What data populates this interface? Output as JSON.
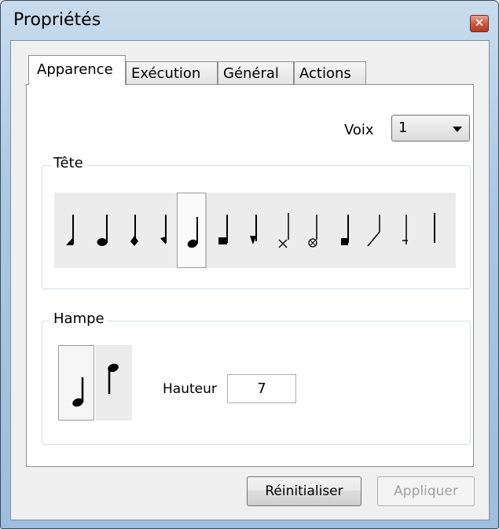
{
  "window": {
    "title": "Propriétés"
  },
  "tabs": [
    {
      "label": "Apparence",
      "active": true
    },
    {
      "label": "Exécution",
      "active": false
    },
    {
      "label": "Général",
      "active": false
    },
    {
      "label": "Actions",
      "active": false
    }
  ],
  "voix": {
    "label": "Voix",
    "value": "1"
  },
  "tete": {
    "title": "Tête",
    "heads": [
      "triangle-head-icon",
      "round-head-icon",
      "diamond-head-icon",
      "half-diamond-head-icon",
      "round-head-selected-icon",
      "square-head-icon",
      "inverted-triangle-head-icon",
      "x-head-icon",
      "circle-x-head-icon",
      "small-square-head-icon",
      "slash-head-icon",
      "plus-head-icon",
      "no-head-icon"
    ],
    "selected_index": 4
  },
  "hampe": {
    "title": "Hampe",
    "options": [
      "stem-up-icon",
      "stem-down-icon"
    ],
    "selected_index": 0,
    "hauteur_label": "Hauteur",
    "hauteur_value": "7"
  },
  "buttons": {
    "reset": "Réinitialiser",
    "apply": "Appliquer"
  }
}
